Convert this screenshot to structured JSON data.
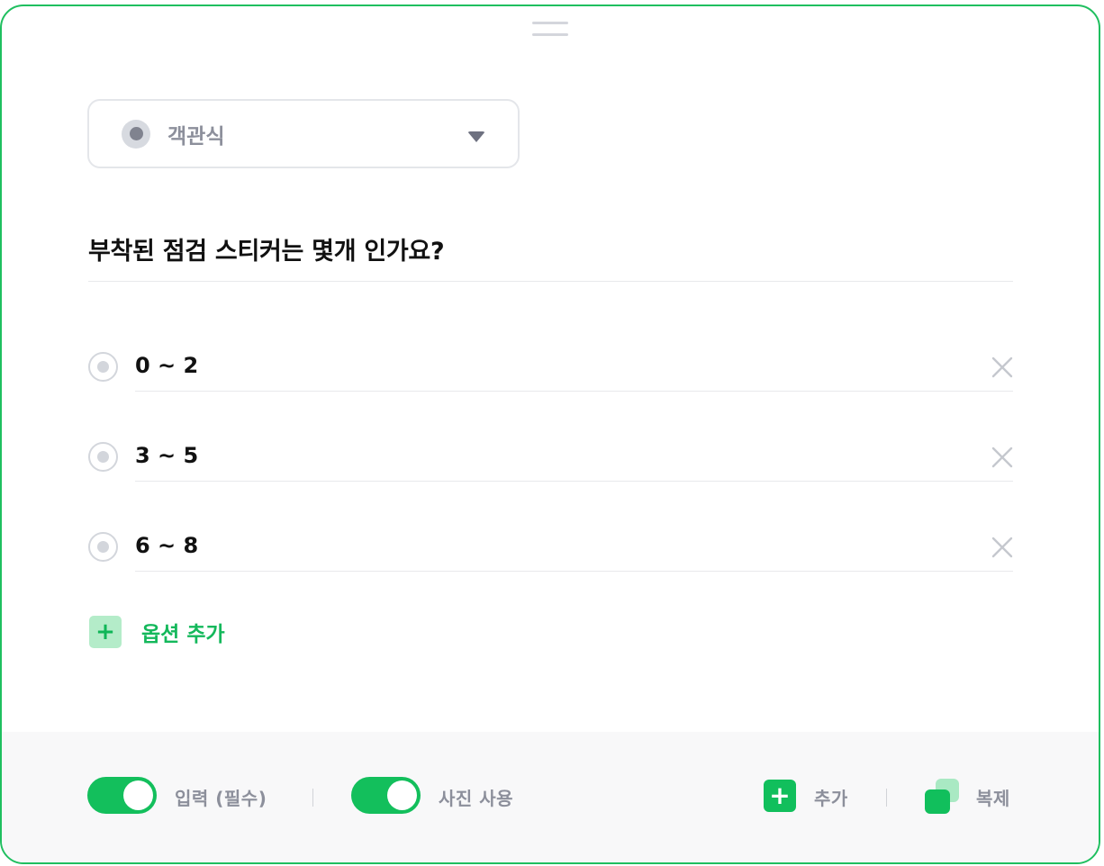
{
  "question_type": {
    "label": "객관식",
    "icon": "radio-icon",
    "dropdown_icon": "caret-down-icon"
  },
  "question": {
    "text": "부착된 점검 스티커는 몇개 인가요?"
  },
  "options": [
    {
      "label": "0 ~ 2"
    },
    {
      "label": "3 ~ 5"
    },
    {
      "label": "6 ~ 8"
    }
  ],
  "add_option": {
    "icon": "plus-icon",
    "label": "옵션 추가"
  },
  "footer": {
    "required_toggle": {
      "label": "입력 (필수)",
      "on": true
    },
    "photo_toggle": {
      "label": "사진 사용",
      "on": true
    },
    "add_action": {
      "icon": "plus-icon",
      "label": "추가"
    },
    "copy_action": {
      "icon": "copy-icon",
      "label": "복제"
    }
  },
  "colors": {
    "accent": "#13bf5c",
    "accent_light": "#b4ecc9",
    "border": "#1fbf5f",
    "muted_text": "#8c8f9b"
  }
}
